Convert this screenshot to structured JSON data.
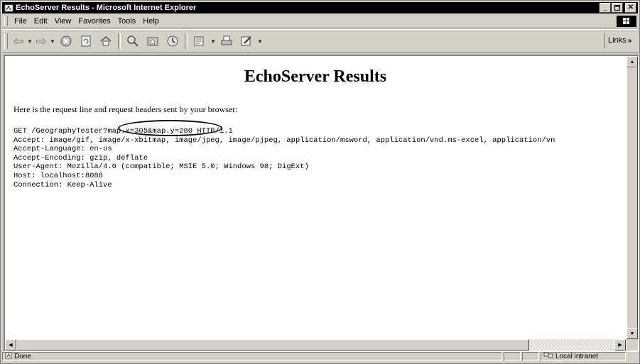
{
  "window": {
    "title": "EchoServer Results - Microsoft Internet Explorer"
  },
  "menubar": {
    "items": [
      "File",
      "Edit",
      "View",
      "Favorites",
      "Tools",
      "Help"
    ]
  },
  "toolbar": {
    "links_label": "Links",
    "buttons": [
      "back-icon",
      "forward-icon",
      "stop-icon",
      "refresh-icon",
      "home-icon",
      "search-icon",
      "favorites-icon",
      "history-icon",
      "mail-icon",
      "print-icon",
      "edit-icon"
    ]
  },
  "page": {
    "heading": "EchoServer Results",
    "intro": "Here is the request line and request headers sent by your browser:",
    "request_prefix": "GET /GeographyTester?",
    "request_highlight": "map.x=305&map.y=280",
    "request_suffix": " HTTP/1.1",
    "headers": [
      "Accept: image/gif, image/x-xbitmap, image/jpeg, image/pjpeg, application/msword, application/vnd.ms-excel, application/vn",
      "Accept-Language: en-us",
      "Accept-Encoding: gzip, deflate",
      "User-Agent: Mozilla/4.0 (compatible; MSIE 5.0; Windows 98; DigExt)",
      "Host: localhost:8088",
      "Connection: Keep-Alive"
    ]
  },
  "statusbar": {
    "status": "Done",
    "zone": "Local intranet"
  }
}
